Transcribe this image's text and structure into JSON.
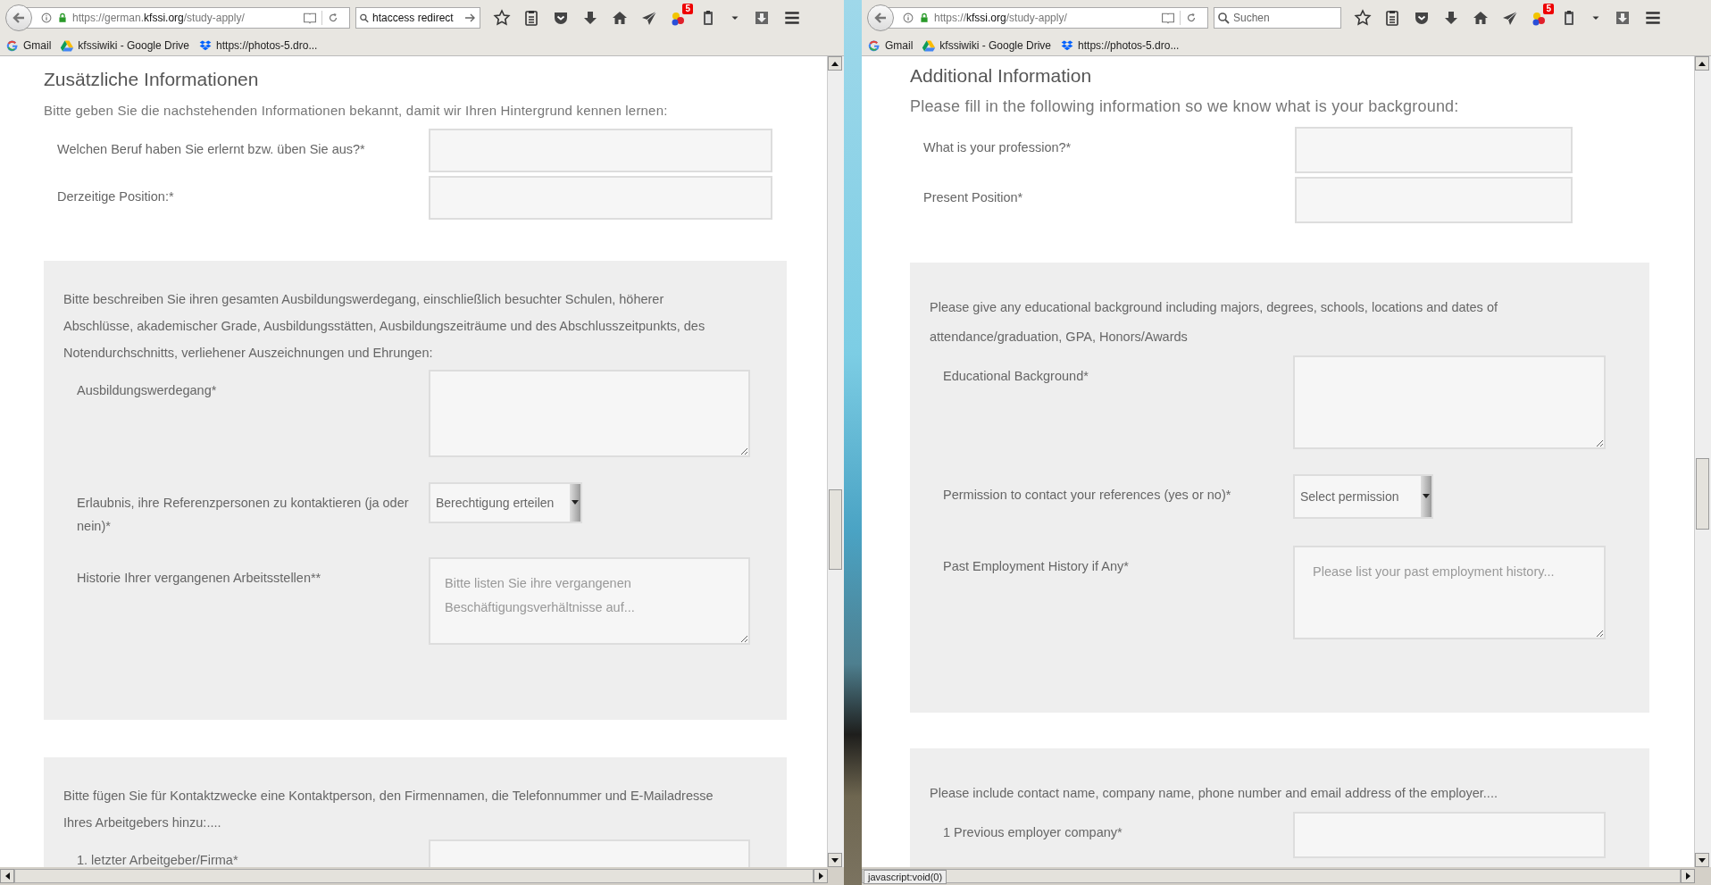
{
  "windows": [
    {
      "url": "https://german.**kfssi.org**/study-apply/",
      "search": {
        "value": "htaccess redirect"
      },
      "badge": "5",
      "bookmarks": [
        {
          "kind": "google",
          "label": "Gmail"
        },
        {
          "kind": "drive",
          "label": "kfssiwiki - Google Drive"
        },
        {
          "kind": "dropbox",
          "label": "https://photos-5.dro..."
        }
      ],
      "page": {
        "heading": "Zusätzliche Informationen",
        "intro": "Bitte geben Sie die nachstehenden Informationen bekannt, damit wir Ihren Hintergrund kennen lernen:",
        "fields": [
          {
            "label": "Welchen Beruf haben Sie erlernt bzw. üben Sie aus?*"
          },
          {
            "label": "Derzeitige Position:*"
          }
        ],
        "panels": [
          {
            "description": "Bitte beschreiben Sie ihren gesamten Ausbildungswerdegang, einschließlich besuchter Schulen, höherer Abschlüsse, akademischer Grade, Ausbildungsstätten, Ausbildungszeiträume und des Abschlusszeitpunkts, des Notendurchschnitts, verliehener Auszeichnungen und Ehrungen:",
            "fields": [
              {
                "kind": "textarea",
                "label": "Ausbildungswerdegang*"
              },
              {
                "kind": "select",
                "label": "Erlaubnis, ihre Referenzpersonen zu kontaktieren (ja oder nein)*",
                "value": "Berechtigung erteilen"
              },
              {
                "kind": "textarea",
                "label": "Historie Ihrer vergangenen Arbeitsstellen**",
                "placeholder": "Bitte listen Sie ihre vergangenen Beschäftigungsverhältnisse auf..."
              }
            ]
          },
          {
            "description": "Bitte fügen Sie für Kontaktzwecke eine Kontaktperson, den Firmennamen, die Telefonnummer und E-Mailadresse Ihres Arbeitgebers hinzu:....",
            "fields": [
              {
                "kind": "text",
                "label": "1. letzter Arbeitgeber/Firma*"
              }
            ]
          }
        ]
      }
    },
    {
      "url": "https://**kfssi.org**/study-apply/",
      "search": {
        "placeholder": "Suchen"
      },
      "badge": "5",
      "bookmarks": [
        {
          "kind": "google",
          "label": "Gmail"
        },
        {
          "kind": "drive",
          "label": "kfssiwiki - Google Drive"
        },
        {
          "kind": "dropbox",
          "label": "https://photos-5.dro..."
        }
      ],
      "status_text": "javascript:void(0)",
      "page": {
        "heading": "Additional Information",
        "intro": "Please fill in the following information so we know what is your background:",
        "fields": [
          {
            "label": "What is your profession?*"
          },
          {
            "label": "Present Position*"
          }
        ],
        "panels": [
          {
            "description": "Please give any educational background including majors, degrees, schools, locations and dates of attendance/graduation, GPA, Honors/Awards",
            "fields": [
              {
                "kind": "textarea",
                "label": "Educational Background*"
              },
              {
                "kind": "select",
                "label": "Permission to contact your references (yes or no)*",
                "value": "Select permission"
              },
              {
                "kind": "textarea",
                "label": "Past Employment History if Any*",
                "placeholder": "Please list your past employment history..."
              }
            ]
          },
          {
            "description": "Please include contact name, company name, phone number and email address of the employer....",
            "fields": [
              {
                "kind": "text",
                "label": "1 Previous employer company*"
              }
            ]
          }
        ]
      }
    }
  ]
}
